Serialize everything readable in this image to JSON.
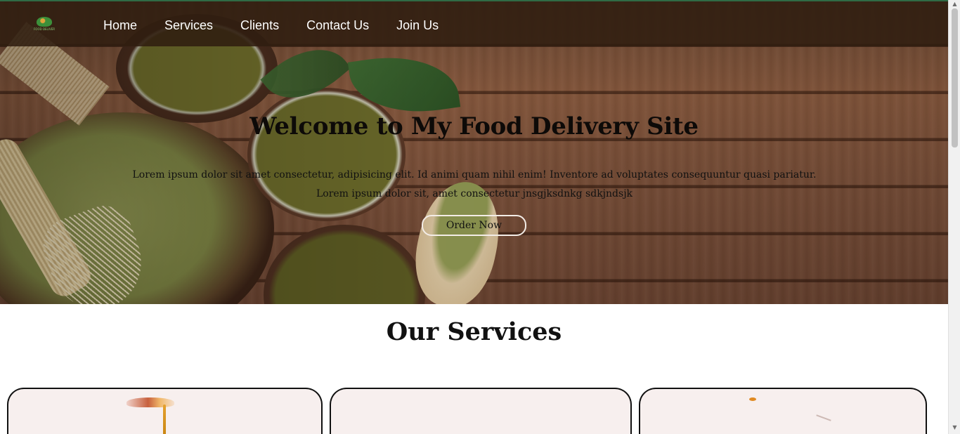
{
  "nav": {
    "logo_text": "FOOD DELIVERY",
    "items": [
      {
        "label": "Home"
      },
      {
        "label": "Services"
      },
      {
        "label": "Clients"
      },
      {
        "label": "Contact Us"
      },
      {
        "label": "Join Us"
      }
    ]
  },
  "hero": {
    "title": "Welcome to My Food Delivery Site",
    "description": "Lorem ipsum dolor sit amet consectetur, adipisicing elit. Id animi quam nihil enim! Inventore ad voluptates consequuntur quasi pariatur. Lorem ipsum dolor sit, amet consectetur jnsgjksdnkg sdkjndsjk",
    "button_label": "Order Now"
  },
  "services": {
    "title": "Our Services"
  },
  "colors": {
    "nav_background": "#301e10",
    "nav_top_border": "#2f6b45",
    "card_background": "#f7efee",
    "text_dark": "#111111"
  },
  "scrollbar": {
    "up_icon": "▲",
    "down_icon": "▼"
  }
}
